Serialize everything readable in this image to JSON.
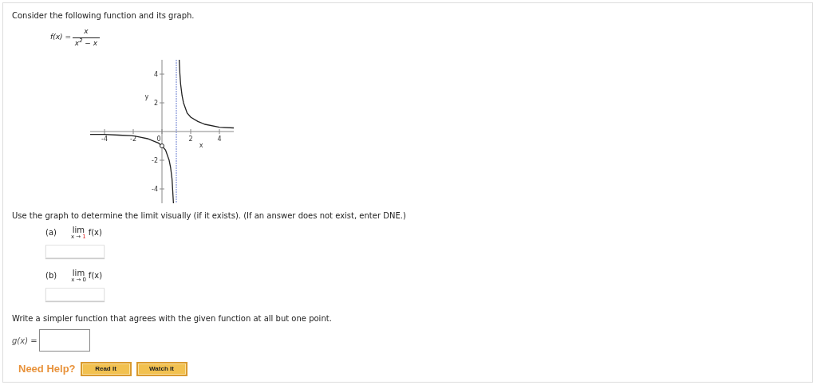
{
  "intro": "Consider the following function and its graph.",
  "function": {
    "name": "f(x) =",
    "numerator": "x",
    "denominator": "x$^{2}$ − x"
  },
  "chart_data": {
    "type": "line",
    "xlabel": "x",
    "ylabel": "y",
    "xlim": [
      -5,
      5
    ],
    "ylim": [
      -5,
      5
    ],
    "xticks": [
      -4,
      -2,
      0,
      2,
      4
    ],
    "yticks": [
      -4,
      -2,
      2,
      4
    ],
    "x": [
      -5,
      -4,
      -3,
      -2,
      -1.5,
      -1,
      -0.5,
      -0.25,
      0,
      0.25,
      0.5,
      0.6,
      0.7,
      0.8,
      1,
      1.2,
      1.25,
      1.3,
      1.4,
      1.5,
      1.75,
      2,
      2.5,
      3,
      4,
      5
    ],
    "series": [
      {
        "color": "#222222",
        "values": [
          -0.2,
          -0.2,
          -0.25,
          -0.3,
          -0.4,
          -0.5,
          -0.7,
          -0.8,
          -1,
          -1.3,
          -2,
          -2.5,
          -3.3,
          -5,
          null,
          5,
          4,
          3.3,
          2.5,
          2,
          1.3,
          1,
          0.7,
          0.5,
          0.3,
          0.25
        ]
      }
    ],
    "ref_lines": [
      {
        "axis": "x",
        "value": 1,
        "color": "#6b7fd0"
      }
    ]
  },
  "instruction": "Use the graph to determine the limit visually (if it exists). (If an answer does not exist, enter DNE.)",
  "parts": [
    {
      "label": "(a)",
      "lim": "lim",
      "approach": "x →",
      "point": "1",
      "point_highlighted": true,
      "expression": "f(x)"
    },
    {
      "label": "(b)",
      "lim": "lim",
      "approach": "x →",
      "point": "0",
      "point_highlighted": false,
      "expression": "f(x)"
    }
  ],
  "simpler": {
    "prompt": "Write a simpler function that agrees with the given function at all but one point.",
    "label": "g(x) ="
  },
  "help": {
    "label": "Need Help?",
    "buttons": [
      "Read It",
      "Watch It"
    ]
  }
}
